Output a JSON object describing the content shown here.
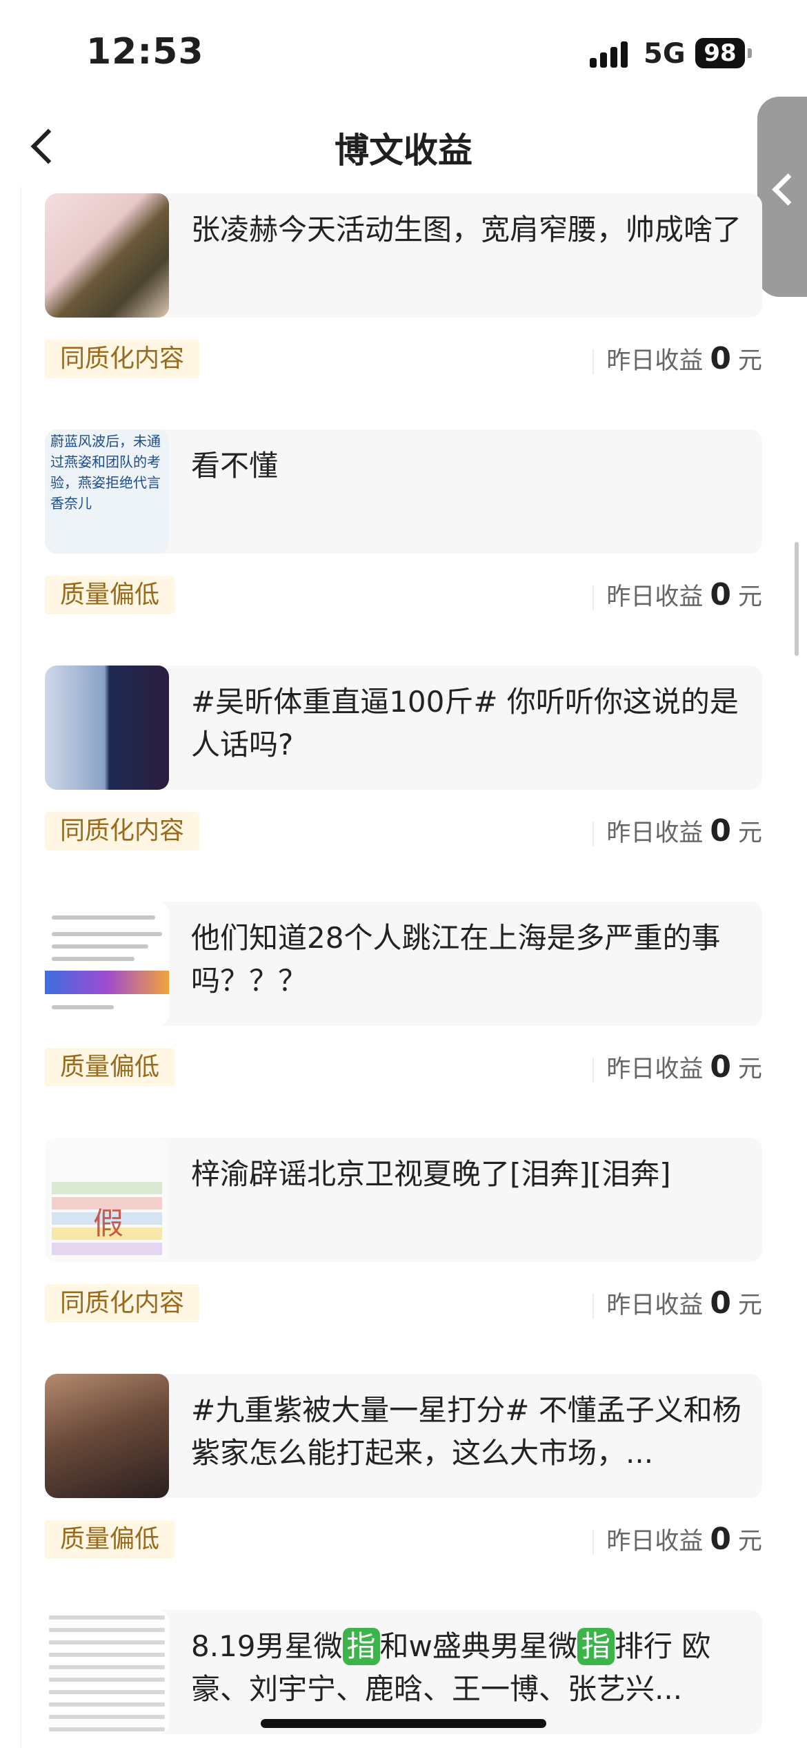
{
  "status": {
    "time": "12:53",
    "network": "5G",
    "battery": "98"
  },
  "nav": {
    "title": "博文收益"
  },
  "earn_label": "昨日收益",
  "earn_unit": "元",
  "items": [
    {
      "text": "张凌赫今天活动生图，宽肩窄腰，帅成啥了",
      "tag": "同质化内容",
      "earn": "0"
    },
    {
      "text": "看不懂",
      "thumb_text": "蔚蓝风波后，未通过燕姿和团队的考验，燕姿拒绝代言香奈儿",
      "tag": "质量偏低",
      "earn": "0"
    },
    {
      "text": "#吴昕体重直逼100斤# 你听听你这说的是人话吗?",
      "tag": "同质化内容",
      "earn": "0"
    },
    {
      "text": "他们知道28个人跳江在上海是多严重的事吗？？？",
      "tag": "质量偏低",
      "earn": "0"
    },
    {
      "text": "梓渝辟谣北京卫视夏晚了[泪奔][泪奔]",
      "thumb_text": "假",
      "tag": "同质化内容",
      "earn": "0"
    },
    {
      "text": "#九重紫被大量一星打分# 不懂孟子义和杨紫家怎么能打起来，这么大市场，...",
      "tag": "质量偏低",
      "earn": "0"
    },
    {
      "text_parts": [
        "8.19男星微",
        "指",
        "和w盛典男星微",
        "指",
        "排行 欧豪、刘宇宁、鹿晗、王一博、张艺兴..."
      ]
    }
  ]
}
